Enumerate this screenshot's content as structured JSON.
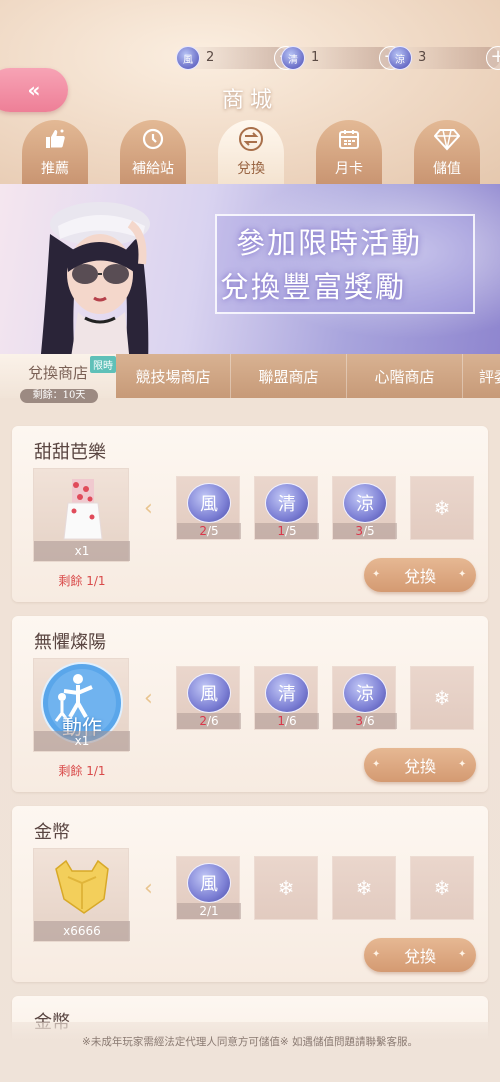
{
  "header": {
    "title": "商城",
    "back_icon": "double-chevron-left-icon",
    "currencies": [
      {
        "icon_char": "風",
        "value": "2"
      },
      {
        "icon_char": "清",
        "value": "1"
      },
      {
        "icon_char": "涼",
        "value": "3"
      }
    ]
  },
  "tabs": [
    {
      "label": "推薦",
      "icon": "thumbs-up-icon"
    },
    {
      "label": "補給站",
      "icon": "clock-icon"
    },
    {
      "label": "兌換",
      "icon": "exchange-icon",
      "active": true
    },
    {
      "label": "月卡",
      "icon": "calendar-icon"
    },
    {
      "label": "儲值",
      "icon": "diamond-icon"
    }
  ],
  "banner": {
    "line1": "參加限時活動",
    "line2": "兌換豐富獎勵"
  },
  "subtabs": [
    {
      "label": "兌換商店",
      "active": true,
      "tag": "限時",
      "remain": "剩餘：10天"
    },
    {
      "label": "競技場商店"
    },
    {
      "label": "聯盟商店"
    },
    {
      "label": "心階商店"
    },
    {
      "label": "評委"
    }
  ],
  "cards": [
    {
      "title": "甜甜芭樂",
      "reward_count": "x1",
      "remain": "剩餘 1/1",
      "slots": [
        {
          "char": "風",
          "have": "2",
          "need": "/5"
        },
        {
          "char": "清",
          "have": "1",
          "need": "/5"
        },
        {
          "char": "涼",
          "have": "3",
          "need": "/5"
        }
      ],
      "button": "兌換"
    },
    {
      "title": "無懼燦陽",
      "reward_count": "x1",
      "reward_label": "動作",
      "remain": "剩餘 1/1",
      "slots": [
        {
          "char": "風",
          "have": "2",
          "need": "/6"
        },
        {
          "char": "清",
          "have": "1",
          "need": "/6"
        },
        {
          "char": "涼",
          "have": "3",
          "need": "/6"
        }
      ],
      "button": "兌換"
    },
    {
      "title": "金幣",
      "reward_count": "x6666",
      "slots": [
        {
          "char": "風",
          "have": "2",
          "need": "/1"
        }
      ],
      "button": "兌換"
    },
    {
      "title": "金幣"
    }
  ],
  "footer": {
    "note": "※未成年玩家需經法定代理人同意方可儲值※ 如遇儲值問題請聯繫客服。"
  }
}
